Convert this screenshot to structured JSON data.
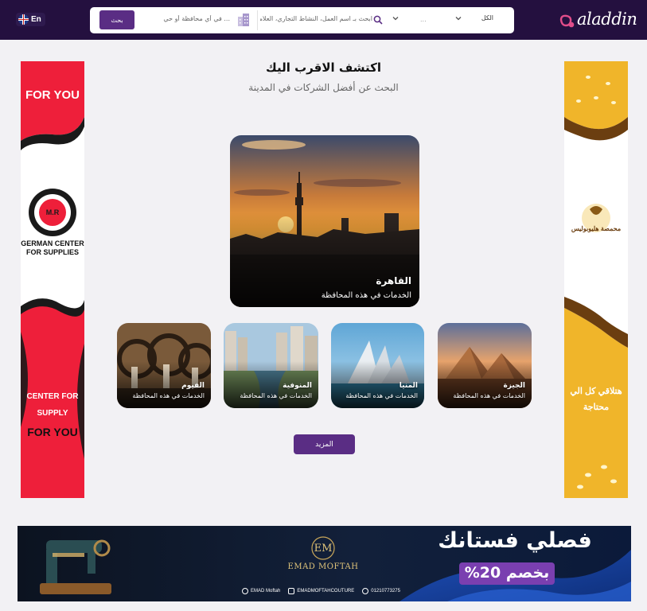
{
  "header": {
    "lang_label": "En",
    "logo_text": "aladdin",
    "search_button": "بحث",
    "location_placeholder": "... في أي محافظة أو حي",
    "keyword_placeholder": "ابحث بـ اسم العمل، النشاط التجاري، العلامة",
    "category_select": "الكل",
    "sub_select": "...",
    "accent_color": "#5a2d84",
    "bar_color": "#24103f"
  },
  "main": {
    "title": "اكتشف الاقرب اليك",
    "subtitle": "البحث عن أفضل الشركات في المدينة",
    "featured": {
      "name": "القاهرة",
      "caption": "الخدمات في هذه المحافظة"
    },
    "cards": [
      {
        "name": "الجيزة",
        "caption": "الخدمات في هذه المحافظة"
      },
      {
        "name": "المنيا",
        "caption": "الخدمات في هذه المحافظة"
      },
      {
        "name": "المنوفية",
        "caption": "الخدمات في هذه المحافظة"
      },
      {
        "name": "الفيوم",
        "caption": "الخدمات في هذه المحافظة"
      }
    ],
    "more_button": "المزيد"
  },
  "ads": {
    "left": {
      "line1": "FOR YOU",
      "logo_initials": "M.R",
      "brand1": "GERMAN CENTER",
      "brand2": "FOR SUPPLIES",
      "line2": "CENTER FOR",
      "line3": "SUPPLY",
      "line4": "FOR YOU"
    },
    "right": {
      "brand": "محمصة هليوبوليس",
      "line1": "هتلاقي كل الي",
      "line2": "محتاجة"
    }
  },
  "banner": {
    "headline": "فصلي فستانك",
    "discount": "بخصم 20%",
    "brand_initials": "EM",
    "brand": "EMAD MOFTAH",
    "facebook": "EMAD Moftah",
    "instagram": "EMADMOFTAHCOUTURE",
    "whatsapp": "01210773275"
  }
}
